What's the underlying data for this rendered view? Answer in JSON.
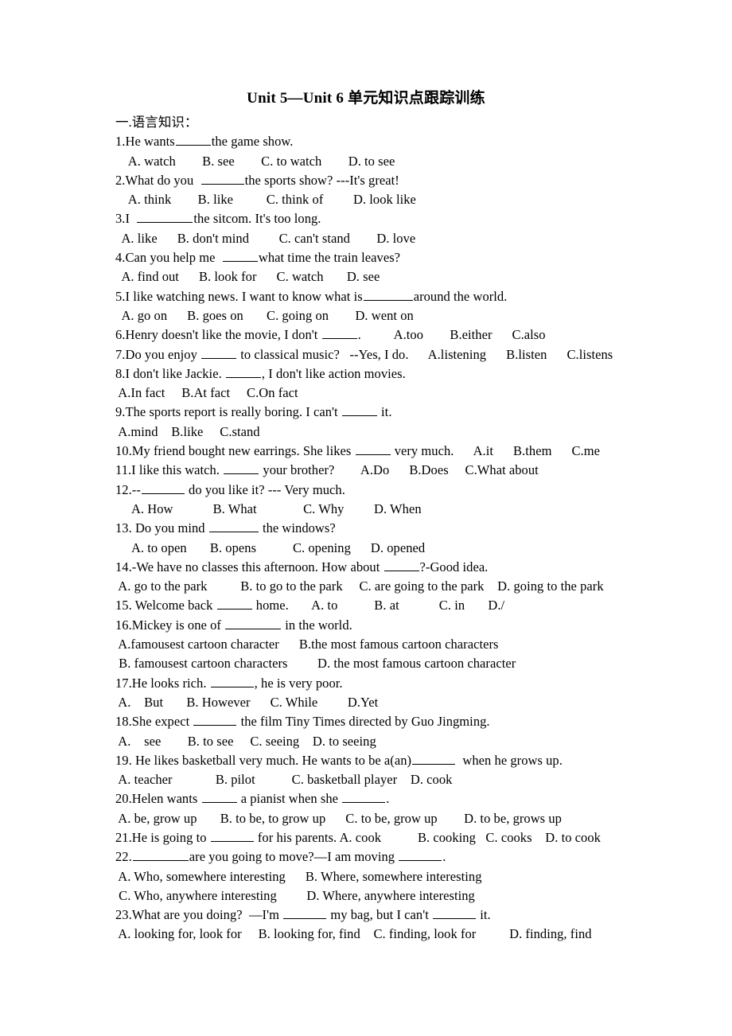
{
  "document": {
    "title": "Unit 5—Unit 6  单元知识点跟踪训练",
    "section_heading": "一.语言知识："
  },
  "questions": [
    {
      "stem_a": "1.He wants",
      "stem_b": "the game show.",
      "options": "    A. watch        B. see        C. to watch        D. to see"
    },
    {
      "stem_a": "2.What do you  ",
      "stem_b": "the sports show? ---It's great!",
      "options": "    A. think        B. like          C. think of         D. look like"
    },
    {
      "stem_a": "3.I  ",
      "stem_b": "the sitcom. It's too long.",
      "options": "  A. like      B. don't mind         C. can't stand        D. love"
    },
    {
      "stem_a": "4.Can you help me  ",
      "stem_b": "what time the train leaves?",
      "options": "  A. find out      B. look for      C. watch       D. see"
    },
    {
      "stem_a": "5.I like watching news. I want to know what is",
      "stem_b": "around the world.",
      "options": "  A. go on      B. goes on       C. going on        D. went on"
    },
    {
      "stem_a": "6.Henry doesn't like the movie, I don't ",
      "stem_b": ".          A.too        B.either      C.also",
      "options": ""
    },
    {
      "stem_a": "7.Do you enjoy ",
      "stem_b": " to classical music?   --Yes, I do.      A.listening      B.listen      C.listens",
      "options": ""
    },
    {
      "stem_a": "8.I don't like Jackie. ",
      "stem_b": ", I don't like action movies.",
      "options": " A.In fact     B.At fact     C.On fact"
    },
    {
      "stem_a": "9.The sports report is really boring. I can't ",
      "stem_b": " it.",
      "options": " A.mind    B.like     C.stand"
    },
    {
      "stem_a": "10.My friend bought new earrings. She likes ",
      "stem_b": " very much.      A.it      B.them      C.me",
      "options": ""
    },
    {
      "stem_a": "11.I like this watch. ",
      "stem_b": " your brother?        A.Do      B.Does     C.What about",
      "options": ""
    },
    {
      "stem_a": "12.--",
      "stem_b": " do you like it? --- Very much.",
      "options": "     A. How            B. What              C. Why         D. When"
    },
    {
      "stem_a": "13. Do you mind ",
      "stem_b": " the windows?",
      "options": "     A. to open       B. opens           C. opening      D. opened"
    },
    {
      "stem_a": "14.-We have no classes this afternoon. How about ",
      "stem_b": "?-Good idea.",
      "options": " A. go to the park          B. to go to the park     C. are going to the park    D. going to the park"
    },
    {
      "stem_a": "15. Welcome back ",
      "stem_b": " home.       A. to           B. at            C. in       D./",
      "options": ""
    },
    {
      "stem_a": "16.Mickey is one of ",
      "stem_b": " in the world.",
      "options": " A.famousest cartoon character      B.the most famous cartoon characters",
      "options2": " B. famousest cartoon characters         D. the most famous cartoon character"
    },
    {
      "stem_a": "17.He looks rich. ",
      "stem_b": ", he is very poor.",
      "options": " A.    But       B. However      C. While         D.Yet"
    },
    {
      "stem_a": "18.She expect ",
      "stem_b": " the film Tiny Times directed by Guo Jingming.",
      "options": " A.    see        B. to see     C. seeing    D. to seeing"
    },
    {
      "stem_a": "19. He likes basketball very much. He wants to be a(an)",
      "stem_b": "  when he grows up.",
      "options": " A. teacher             B. pilot           C. basketball player    D. cook"
    },
    {
      "stem_a": "20.Helen wants ",
      "stem_b": " a pianist when she ",
      "stem_c": ".",
      "options": " A. be, grow up       B. to be, to grow up      C. to be, grow up        D. to be, grows up"
    },
    {
      "stem_a": "21.He is going to ",
      "stem_b": " for his parents. A. cook           B. cooking   C. cooks    D. to cook",
      "options": ""
    },
    {
      "stem_a": "22.",
      "stem_b": "are you going to move?—I am moving ",
      "stem_c": ".",
      "options": " A. Who, somewhere interesting      B. Where, somewhere interesting",
      "options2": " C. Who, anywhere interesting         D. Where, anywhere interesting"
    },
    {
      "stem_a": "23.What are you doing?  —I'm ",
      "stem_b": " my bag, but I can't ",
      "stem_c": " it.",
      "options": " A. looking for, look for     B. looking for, find    C. finding, look for          D. finding, find"
    }
  ]
}
